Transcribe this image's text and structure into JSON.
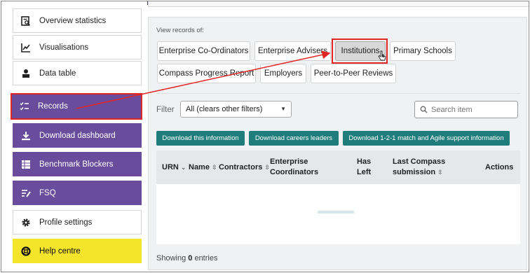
{
  "sidebar": {
    "items": [
      {
        "label": "Overview statistics",
        "icon": "overview-stats-icon",
        "style": "white"
      },
      {
        "label": "Visualisations",
        "icon": "chart-icon",
        "style": "white"
      },
      {
        "label": "Data table",
        "icon": "user-table-icon",
        "style": "white"
      },
      {
        "label": "Records",
        "icon": "list-check-icon",
        "style": "purple"
      },
      {
        "label": "Download dashboard",
        "icon": "download-icon",
        "style": "purple"
      },
      {
        "label": "Benchmark Blockers",
        "icon": "grid-icon",
        "style": "purple"
      },
      {
        "label": "FSQ",
        "icon": "list-pen-icon",
        "style": "purple"
      },
      {
        "label": "Profile settings",
        "icon": "gear-icon",
        "style": "white"
      },
      {
        "label": "Help centre",
        "icon": "lifebuoy-icon",
        "style": "yellow"
      }
    ]
  },
  "records": {
    "view_label": "View records of:",
    "buttons": [
      "Enterprise Co-Ordinators",
      "Enterprise Advisers",
      "Institutions",
      "Primary Schools",
      "Compass Progress Report",
      "Employers",
      "Peer-to-Peer Reviews"
    ],
    "active": "Institutions"
  },
  "filter": {
    "label": "Filter",
    "value": "All (clears other filters)"
  },
  "search": {
    "placeholder": "Search item"
  },
  "downloads": [
    "Download this information",
    "Download careers leaders",
    "Download 1-2-1 match and Agile support information"
  ],
  "table": {
    "columns": {
      "urn": "URN",
      "name": "Name",
      "contractors": "Contractors",
      "ec_line1": "Enterprise",
      "ec_line2": "Coordinators",
      "hl_line1": "Has",
      "hl_line2": "Left",
      "lcs_line1": "Last Compass",
      "lcs_line2": "submission",
      "actions": "Actions"
    }
  },
  "footer": {
    "showing_prefix": "Showing ",
    "count": "0",
    "showing_suffix": " entries"
  },
  "colors": {
    "purple": "#6a4c9c",
    "yellow": "#f5e52a",
    "teal": "#1f7d7b",
    "highlight_red": "#e32424"
  }
}
